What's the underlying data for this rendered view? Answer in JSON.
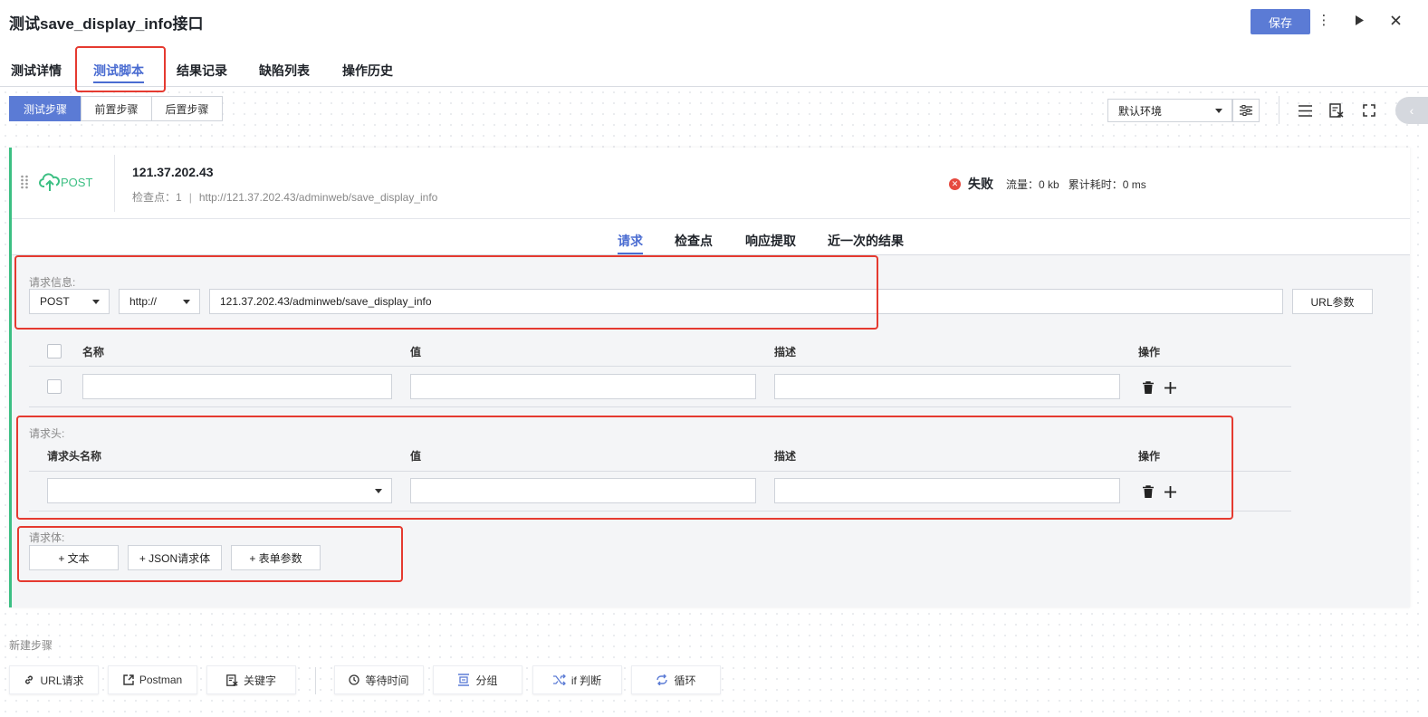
{
  "header": {
    "title": "测试save_display_info接口",
    "save_label": "保存"
  },
  "tabs": [
    {
      "label": "测试详情"
    },
    {
      "label": "测试脚本",
      "active": true
    },
    {
      "label": "结果记录"
    },
    {
      "label": "缺陷列表"
    },
    {
      "label": "操作历史"
    }
  ],
  "step_phase": [
    "测试步骤",
    "前置步骤",
    "后置步骤"
  ],
  "environment": {
    "selected": "默认环境"
  },
  "step": {
    "method": "POST",
    "host": "121.37.202.43",
    "checkpoint_label": "检查点：",
    "checkpoint_count": "1",
    "url": "http://121.37.202.43/adminweb/save_display_info",
    "status": "失败",
    "traffic_label": "流量：",
    "traffic_value": "0 kb",
    "elapsed_label": "累计耗时：",
    "elapsed_value": "0 ms"
  },
  "sub_tabs": [
    {
      "label": "请求",
      "active": true
    },
    {
      "label": "检查点"
    },
    {
      "label": "响应提取"
    },
    {
      "label": "近一次的结果"
    }
  ],
  "request_info": {
    "label": "请求信息:",
    "method": "POST",
    "protocol": "http://",
    "url": "121.37.202.43/adminweb/save_display_info",
    "url_params_btn": "URL参数"
  },
  "params_table": {
    "headers": [
      "名称",
      "值",
      "描述",
      "操作"
    ]
  },
  "headers_section": {
    "label": "请求头:",
    "headers": [
      "请求头名称",
      "值",
      "描述",
      "操作"
    ]
  },
  "body_section": {
    "label": "请求体:",
    "buttons": [
      "+ 文本",
      "+ JSON请求体",
      "+ 表单参数"
    ]
  },
  "new_step": {
    "label": "新建步骤",
    "buttons": [
      {
        "label": "URL请求",
        "icon": "link-icon"
      },
      {
        "label": "Postman",
        "icon": "import-icon"
      },
      {
        "label": "关键字",
        "icon": "keyword-icon"
      },
      {
        "label": "等待时间",
        "icon": "clock-icon"
      },
      {
        "label": "分组",
        "icon": "group-icon"
      },
      {
        "label": "if 判断",
        "icon": "shuffle-icon"
      },
      {
        "label": "循环",
        "icon": "loop-icon"
      }
    ]
  },
  "colors": {
    "accent": "#5b7bd5",
    "success_bar": "#3cbf83",
    "error": "#e64a3f",
    "highlight": "#e53a30"
  }
}
